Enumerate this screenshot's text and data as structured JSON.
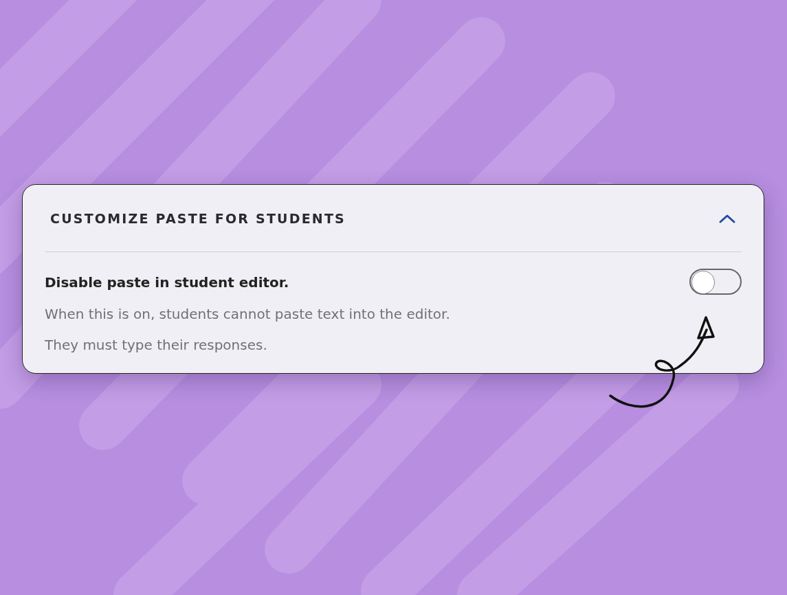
{
  "panel": {
    "title": "CUSTOMIZE PASTE FOR STUDENTS",
    "expanded": true
  },
  "setting": {
    "label": "Disable paste in student editor.",
    "on": false,
    "description": [
      "When this is on, students cannot paste text into the editor.",
      "They must type their responses."
    ]
  }
}
